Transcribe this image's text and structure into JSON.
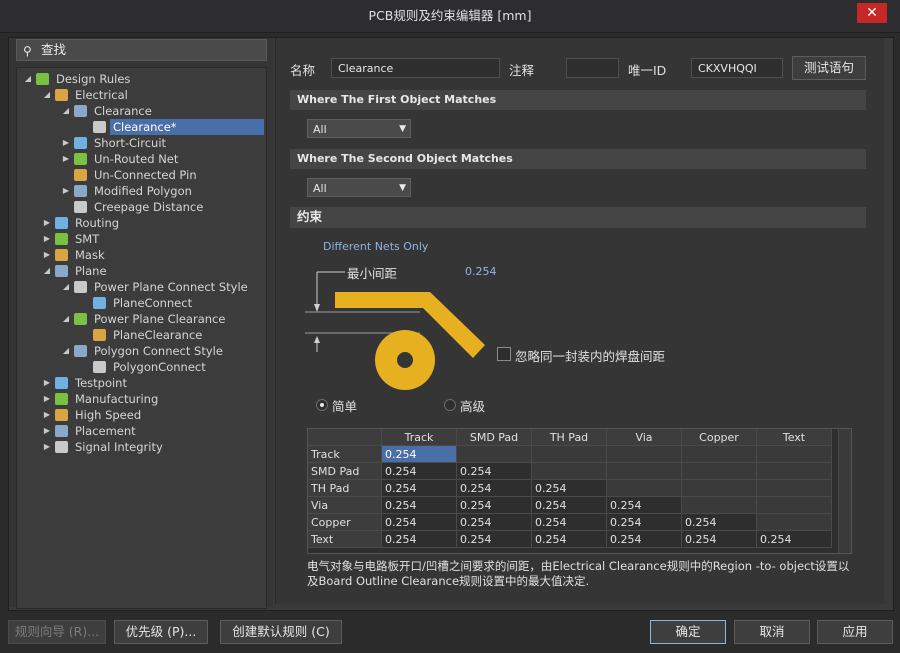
{
  "window": {
    "title": "PCB规则及约束编辑器 [mm]",
    "close_glyph": "✕"
  },
  "search": {
    "placeholder": "查找"
  },
  "tree": [
    {
      "label": "Design Rules",
      "level": 0,
      "arrow": "◢",
      "icon": "folder-rules-icon"
    },
    {
      "label": "Electrical",
      "level": 1,
      "arrow": "◢",
      "icon": "electrical-icon"
    },
    {
      "label": "Clearance",
      "level": 2,
      "arrow": "◢",
      "icon": "clearance-icon"
    },
    {
      "label": "Clearance*",
      "level": 3,
      "arrow": "",
      "icon": "clearance-rule-icon",
      "selected": true
    },
    {
      "label": "Short-Circuit",
      "level": 2,
      "arrow": "▶",
      "icon": "short-circuit-icon"
    },
    {
      "label": "Un-Routed Net",
      "level": 2,
      "arrow": "▶",
      "icon": "unrouted-net-icon"
    },
    {
      "label": "Un-Connected Pin",
      "level": 2,
      "arrow": "",
      "icon": "unconnected-pin-icon"
    },
    {
      "label": "Modified Polygon",
      "level": 2,
      "arrow": "▶",
      "icon": "modified-polygon-icon"
    },
    {
      "label": "Creepage Distance",
      "level": 2,
      "arrow": "",
      "icon": "creepage-icon"
    },
    {
      "label": "Routing",
      "level": 1,
      "arrow": "▶",
      "icon": "routing-icon"
    },
    {
      "label": "SMT",
      "level": 1,
      "arrow": "▶",
      "icon": "smt-icon"
    },
    {
      "label": "Mask",
      "level": 1,
      "arrow": "▶",
      "icon": "mask-icon"
    },
    {
      "label": "Plane",
      "level": 1,
      "arrow": "◢",
      "icon": "plane-icon"
    },
    {
      "label": "Power Plane Connect Style",
      "level": 2,
      "arrow": "◢",
      "icon": "plane-connect-style-icon"
    },
    {
      "label": "PlaneConnect",
      "level": 3,
      "arrow": "",
      "icon": "plane-connect-icon"
    },
    {
      "label": "Power Plane Clearance",
      "level": 2,
      "arrow": "◢",
      "icon": "plane-clearance-style-icon"
    },
    {
      "label": "PlaneClearance",
      "level": 3,
      "arrow": "",
      "icon": "plane-clearance-icon"
    },
    {
      "label": "Polygon Connect Style",
      "level": 2,
      "arrow": "◢",
      "icon": "polygon-connect-style-icon"
    },
    {
      "label": "PolygonConnect",
      "level": 3,
      "arrow": "",
      "icon": "polygon-connect-icon"
    },
    {
      "label": "Testpoint",
      "level": 1,
      "arrow": "▶",
      "icon": "testpoint-icon"
    },
    {
      "label": "Manufacturing",
      "level": 1,
      "arrow": "▶",
      "icon": "manufacturing-icon"
    },
    {
      "label": "High Speed",
      "level": 1,
      "arrow": "▶",
      "icon": "high-speed-icon"
    },
    {
      "label": "Placement",
      "level": 1,
      "arrow": "▶",
      "icon": "placement-icon"
    },
    {
      "label": "Signal Integrity",
      "level": 1,
      "arrow": "▶",
      "icon": "signal-integrity-icon"
    }
  ],
  "header": {
    "name_label": "名称",
    "name_value": "Clearance",
    "comment_label": "注释",
    "comment_value": "",
    "uid_label": "唯一ID",
    "uid_value": "CKXVHQQI",
    "test_button": "测试语句"
  },
  "first_match": {
    "title": "Where The First Object Matches",
    "value": "All"
  },
  "second_match": {
    "title": "Where The Second Object Matches",
    "value": "All"
  },
  "constraints": {
    "title": "约束",
    "net_scope": "Different Nets Only",
    "min_clearance_label": "最小间距",
    "min_clearance_value": "0.254",
    "ignore_pad_label": "忽略同一封装内的焊盘间距",
    "mode_simple": "简单",
    "mode_advanced": "高级"
  },
  "grid": {
    "columns": [
      "",
      "Track",
      "SMD Pad",
      "TH Pad",
      "Via",
      "Copper",
      "Text"
    ],
    "rows": [
      {
        "name": "Track",
        "cells": [
          "0.254",
          "",
          "",
          "",
          "",
          ""
        ]
      },
      {
        "name": "SMD Pad",
        "cells": [
          "0.254",
          "0.254",
          "",
          "",
          "",
          ""
        ]
      },
      {
        "name": "TH Pad",
        "cells": [
          "0.254",
          "0.254",
          "0.254",
          "",
          "",
          ""
        ]
      },
      {
        "name": "Via",
        "cells": [
          "0.254",
          "0.254",
          "0.254",
          "0.254",
          "",
          ""
        ]
      },
      {
        "name": "Copper",
        "cells": [
          "0.254",
          "0.254",
          "0.254",
          "0.254",
          "0.254",
          ""
        ]
      },
      {
        "name": "Text",
        "cells": [
          "0.254",
          "0.254",
          "0.254",
          "0.254",
          "0.254",
          "0.254"
        ]
      }
    ]
  },
  "description": "电气对象与电路板开口/凹槽之间要求的间距，由Electrical Clearance规则中的Region -to- object设置以及Board Outline Clearance规则设置中的最大值决定.",
  "footer": {
    "wizard_button": "规则向导 (R)...",
    "priority_button": "优先级 (P)...",
    "default_rules_button": "创建默认规则 (C)",
    "ok_button": "确定",
    "cancel_button": "取消",
    "apply_button": "应用"
  },
  "colors": {
    "accent": "#4a6ea8",
    "track": "#e6b020",
    "close": "#c62828"
  }
}
